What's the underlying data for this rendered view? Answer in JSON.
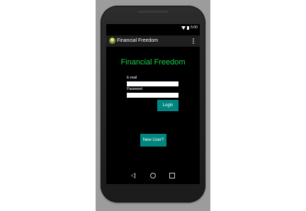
{
  "status_bar": {
    "time": "5:00"
  },
  "app_bar": {
    "title": "Financial Freedom"
  },
  "main": {
    "heading": "Financial Freedom",
    "email_label": "E-mail",
    "password_label": "Password",
    "email_value": "",
    "password_value": "",
    "login_label": "Login",
    "new_user_label": "New User?"
  },
  "colors": {
    "accent_button": "#00867f",
    "heading_green": "#16d24b",
    "background": "#000000"
  }
}
